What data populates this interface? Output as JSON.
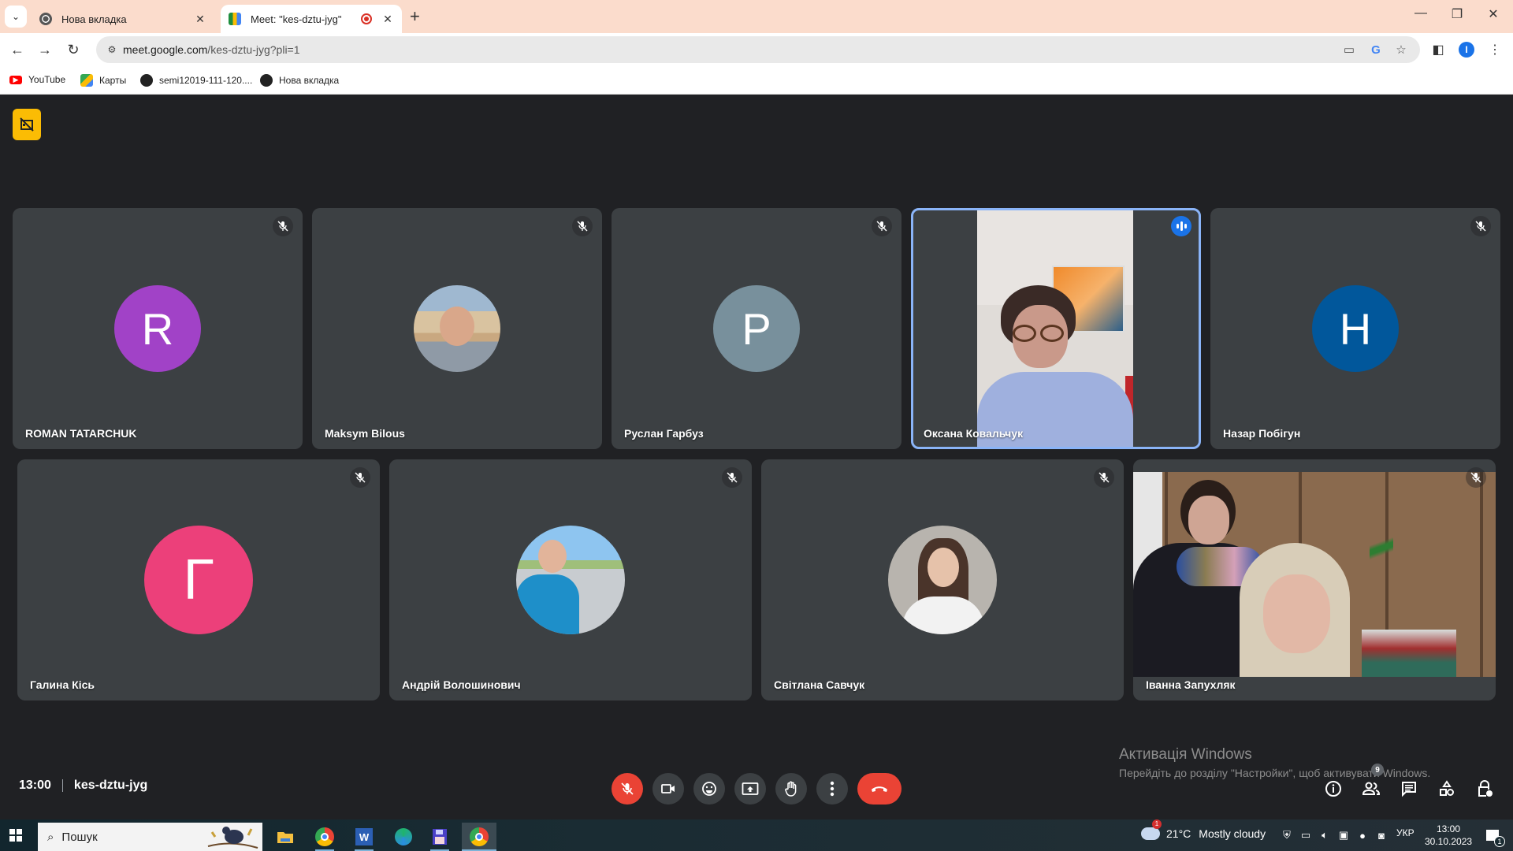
{
  "browser": {
    "tabs": [
      {
        "title": "Нова вкладка",
        "active": false
      },
      {
        "title": "Meet: \"kes-dztu-jyg\"",
        "active": true,
        "recording": true
      }
    ],
    "new_tab_symbol": "+",
    "url": {
      "host": "meet.google.com",
      "path": "/kes-dztu-jyg?pli=1"
    },
    "profile_initial": "I",
    "bookmarks": [
      {
        "label": "YouTube",
        "icon": "youtube-icon"
      },
      {
        "label": "Карты",
        "icon": "maps-icon"
      },
      {
        "label": "semi12019-111-120....",
        "icon": "globe-icon"
      },
      {
        "label": "Нова вкладка",
        "icon": "globe-icon"
      }
    ]
  },
  "meet": {
    "meeting_time": "13:00",
    "meeting_code": "kes-dztu-jyg",
    "participants_count": "9",
    "participants": [
      {
        "name": "ROMAN TATARCHUK",
        "initial": "R",
        "avatar_color": "#a142c7",
        "muted": true,
        "type": "initial"
      },
      {
        "name": "Maksym Bilous",
        "muted": true,
        "type": "photo"
      },
      {
        "name": "Руслан Гарбуз",
        "initial": "Р",
        "avatar_color": "#78909c",
        "muted": true,
        "type": "initial"
      },
      {
        "name": "Оксана Ковальчук",
        "muted": false,
        "speaking": true,
        "type": "video"
      },
      {
        "name": "Назар Побігун",
        "initial": "Н",
        "avatar_color": "#01579b",
        "muted": true,
        "type": "initial"
      },
      {
        "name": "Галина Кісь",
        "initial": "Г",
        "avatar_color": "#ec407a",
        "muted": true,
        "type": "initial"
      },
      {
        "name": "Андрій Волошинович",
        "muted": true,
        "type": "photo"
      },
      {
        "name": "Світлана Савчук",
        "muted": true,
        "type": "photo"
      },
      {
        "name": "Іванна Запухляк",
        "muted": true,
        "type": "video"
      }
    ],
    "colors": {
      "background": "#202124",
      "tile": "#3c4043",
      "danger": "#ea4335",
      "speaking_outline": "#8ab4f8",
      "recording_badge": "#fbbc04"
    }
  },
  "windows_activation": {
    "title": "Активація Windows",
    "subtitle": "Перейдіть до розділу \"Настройки\", щоб активувати Windows."
  },
  "taskbar": {
    "search_placeholder": "Пошук",
    "weather": {
      "temp": "21°C",
      "condition": "Mostly cloudy",
      "badge": "1"
    },
    "language": "УКР",
    "time": "13:00",
    "date": "30.10.2023",
    "notifications_count": "1",
    "apps": [
      "file-explorer",
      "chrome-k",
      "word",
      "edge-beta",
      "save-app",
      "chrome-i"
    ]
  }
}
